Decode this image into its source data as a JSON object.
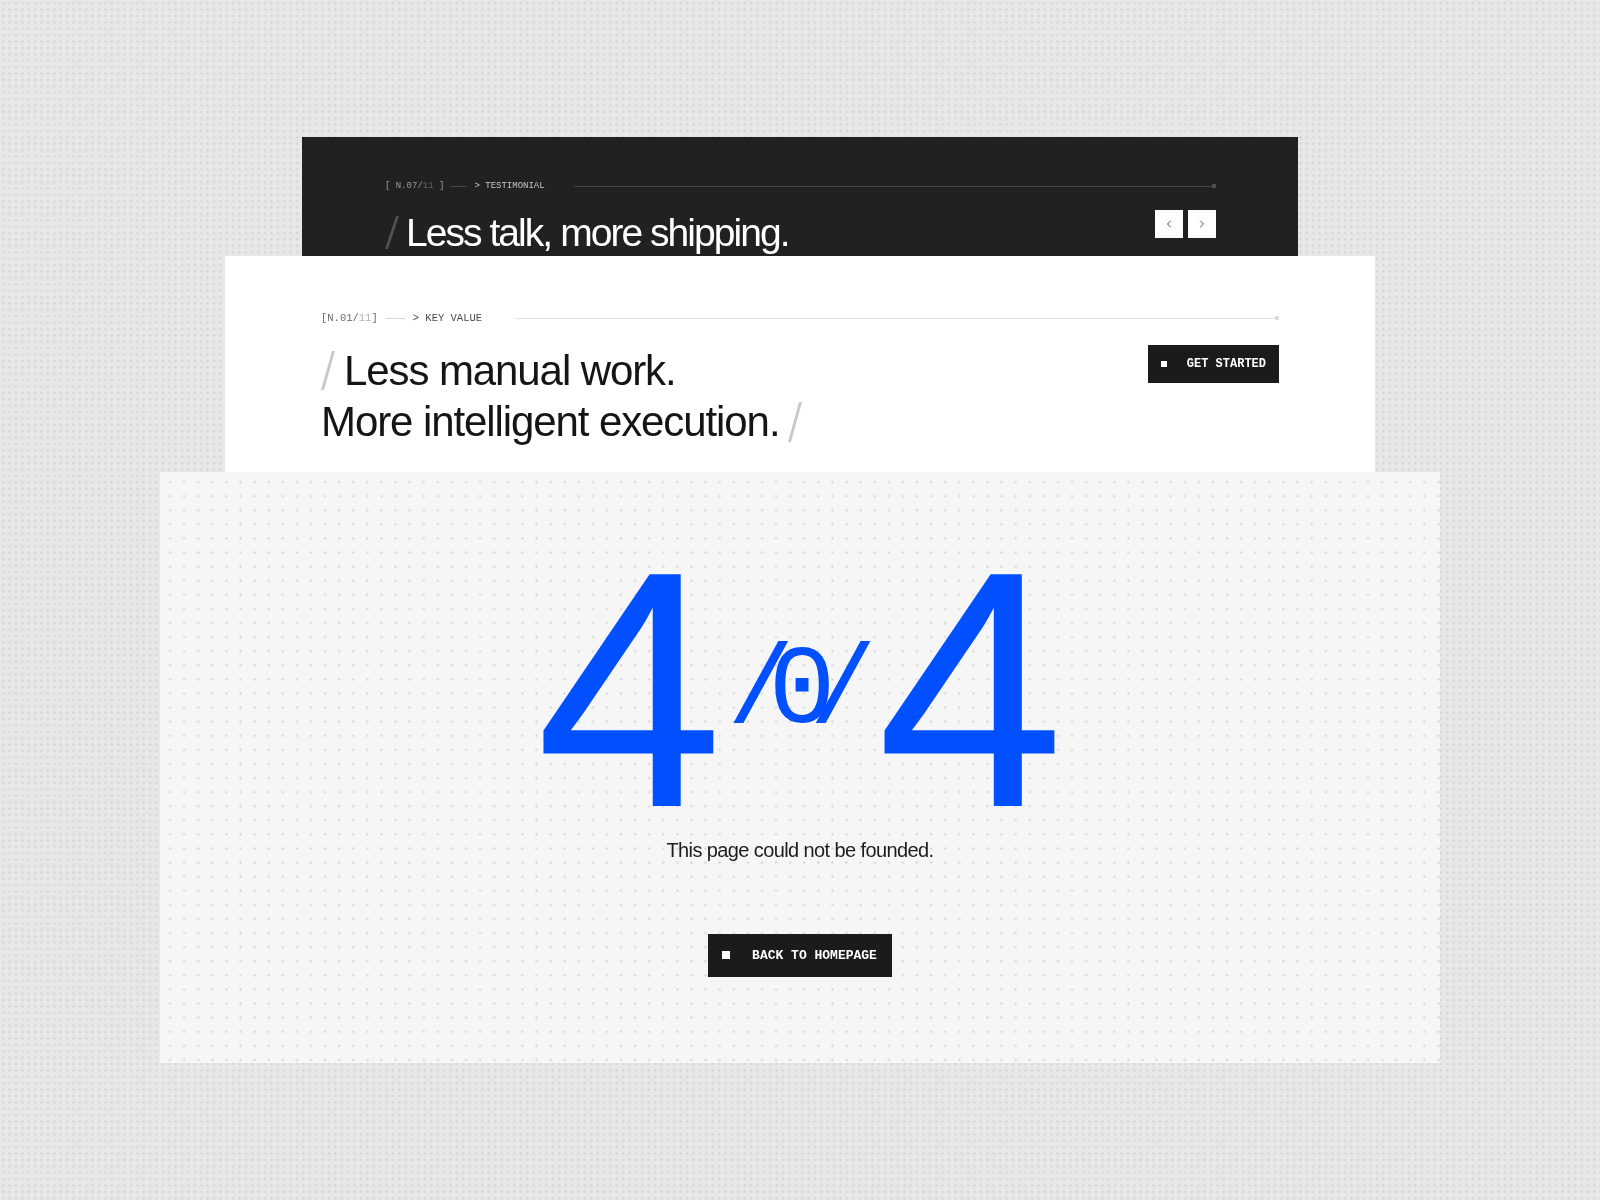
{
  "testimonial_section": {
    "counter": {
      "prefix": "[ N.07/",
      "total": "11",
      "suffix": " ]"
    },
    "label": "> TESTIMONIAL",
    "title": "Less talk, more shipping."
  },
  "key_value_section": {
    "counter": {
      "prefix": "[N.01/",
      "total": "11",
      "suffix": "]"
    },
    "label": "> KEY VALUE",
    "headline": [
      "Less manual work.",
      "More intelligent execution."
    ],
    "button": "GET STARTED"
  },
  "error": {
    "code": [
      {
        "kind": "digit",
        "text": "4"
      },
      {
        "kind": "mono",
        "text": "/0/"
      },
      {
        "kind": "digit",
        "text": "4"
      }
    ],
    "message": "This page could not be founded.",
    "button": "BACK TO HOMEPAGE"
  }
}
